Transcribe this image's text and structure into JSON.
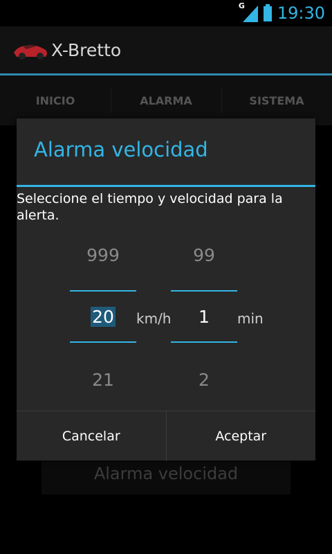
{
  "status_bar": {
    "time": "19:30",
    "network": "G"
  },
  "app": {
    "title": "X-Bretto"
  },
  "tabs": [
    "INICIO",
    "ALARMA",
    "SISTEMA"
  ],
  "background": {
    "button_label": "Alarma velocidad"
  },
  "dialog": {
    "title": "Alarma velocidad",
    "message": "Seleccione el tiempo y velocidad para la alerta.",
    "speed_picker": {
      "above": "999",
      "value": "20",
      "below": "21",
      "unit": "km/h"
    },
    "time_picker": {
      "above": "99",
      "value": "1",
      "below": "2",
      "unit": "min"
    },
    "buttons": {
      "cancel": "Cancelar",
      "accept": "Aceptar"
    }
  },
  "colors": {
    "accent": "#33b5e5"
  }
}
